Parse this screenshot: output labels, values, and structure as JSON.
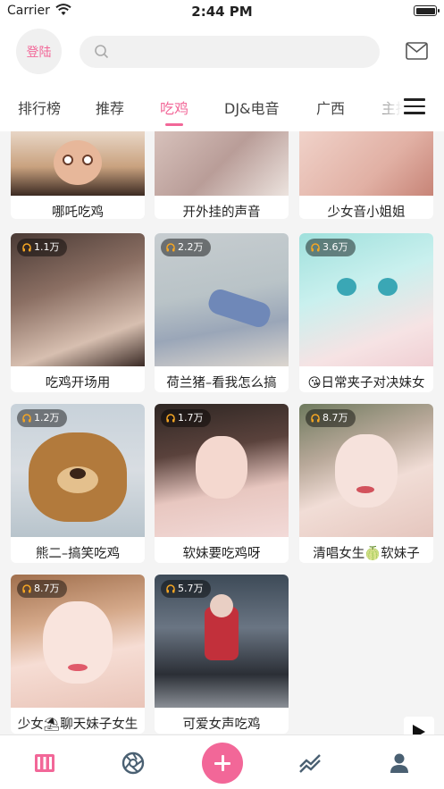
{
  "status": {
    "carrier": "Carrier",
    "time": "2:44 PM"
  },
  "header": {
    "login_label": "登陆",
    "search_placeholder": ""
  },
  "tabs": [
    {
      "label": "排行榜",
      "active": false
    },
    {
      "label": "推荐",
      "active": false
    },
    {
      "label": "吃鸡",
      "active": true
    },
    {
      "label": "DJ&电音",
      "active": false
    },
    {
      "label": "广西",
      "active": false
    },
    {
      "label": "主播",
      "active": false
    }
  ],
  "cards": [
    {
      "title": "哪吒吃鸡",
      "plays": ""
    },
    {
      "title": "开外挂的声音",
      "plays": ""
    },
    {
      "title": "少女音小姐姐",
      "plays": ""
    },
    {
      "title": "吃鸡开场用",
      "plays": "1.1万"
    },
    {
      "title": "荷兰猪–看我怎么搞",
      "plays": "2.2万"
    },
    {
      "title": "😘日常夹子对决妹女",
      "plays": "3.6万"
    },
    {
      "title": "熊二–搞笑吃鸡",
      "plays": "1.2万"
    },
    {
      "title": "软妹要吃鸡呀",
      "plays": "1.7万"
    },
    {
      "title": "清唱女生🍈软妹子",
      "plays": "8.7万"
    },
    {
      "title": "少女⛱聊天妹子女生",
      "plays": "8.7万"
    },
    {
      "title": "可爱女声吃鸡",
      "plays": "5.7万"
    }
  ],
  "colors": {
    "accent": "#f26798",
    "badge_bg": "rgba(0,0,0,0.45)",
    "badge_icon": "#f5a623"
  },
  "icons": {
    "tabbar": [
      "piano-icon",
      "aperture-icon",
      "add-icon",
      "trend-icon",
      "user-icon"
    ],
    "header": [
      "search-icon",
      "mail-icon"
    ],
    "misc": [
      "menu-icon",
      "play-icon",
      "headphones-icon",
      "wifi-icon",
      "battery-icon"
    ]
  }
}
